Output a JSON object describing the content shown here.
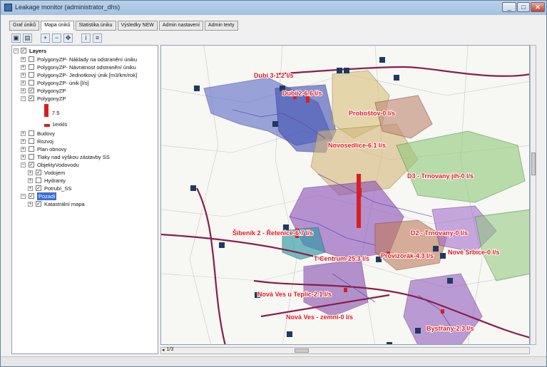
{
  "window": {
    "title": "Leakage monitor (administrator_dhs)"
  },
  "window_buttons": {
    "minimize": "_",
    "maximize": "□",
    "close": "✕"
  },
  "tabs": [
    "Graf úniků",
    "Mapa úniků",
    "Statistika úniku",
    "Výsledky NEW",
    "Admin nastavení",
    "Admin texty"
  ],
  "active_tab": "Mapa úniků",
  "toolbar": {
    "icons": [
      "save-icon",
      "print-icon",
      "zoom-in-icon",
      "zoom-out-icon",
      "pan-icon",
      "info-icon",
      "legend-icon"
    ]
  },
  "layers": {
    "root": "Layers",
    "items": [
      {
        "label": "PolygonyZP- Náklady na odstranění úniku",
        "checked": false,
        "expand": "+"
      },
      {
        "label": "PolygonyZP- Návratnost odstranění úniku",
        "checked": false,
        "expand": "+"
      },
      {
        "label": "PolygonyZP- Jednotkový únik [m3/km/rok]",
        "checked": false,
        "expand": "+"
      },
      {
        "label": "PolygonyZP- únik [l/s]",
        "checked": false,
        "expand": "+"
      },
      {
        "label": "PolygonyZP",
        "checked": true,
        "expand": "+"
      },
      {
        "label": "PolygonyZP",
        "checked": true,
        "expand": "−"
      },
      {
        "label": "Budovy",
        "checked": false,
        "expand": "+"
      },
      {
        "label": "Rozvoj",
        "checked": false,
        "expand": "+"
      },
      {
        "label": "Plan obnovy",
        "checked": false,
        "expand": "+"
      },
      {
        "label": "Tlaky nad výškou zástavby SS",
        "checked": false,
        "expand": "+"
      },
      {
        "label": "ObjektyVodovodu",
        "checked": true,
        "expand": "−"
      },
      {
        "label": "Vodojem",
        "checked": true,
        "expand": "+"
      },
      {
        "label": "Hydranty",
        "checked": false,
        "expand": "+"
      },
      {
        "label": "Potrubí_SS",
        "checked": true,
        "expand": "+"
      },
      {
        "label": "Pozadí",
        "checked": true,
        "expand": "−"
      },
      {
        "label": "Katastrální mapa",
        "checked": true,
        "expand": "+"
      }
    ],
    "legend_high": "7.5",
    "legend_low": "1exkls"
  },
  "map_labels": [
    "Dubí 3-1.2 l/s",
    "Dubí 2-6.6 l/s",
    "Proboštov-0 l/s",
    "Novosedlice-6.1 l/s",
    "D3 - Trnovany jih-0 l/s",
    "Šibeník 2 - Řetenice-6.7 l/s",
    "D2 - Trnovany-0 l/s",
    "Nové Srbice-0 l/s",
    "T-Centrum-25.3 l/s",
    "Provizorák-4.3 l/s",
    "Nová Ves u Teplic-2.1 l/s",
    "Nová Ves - zemní-0 l/s",
    "Bystřany-2.3 l/s"
  ],
  "leak_rates": [
    1.2,
    6.6,
    0,
    6.1,
    0,
    6.7,
    0,
    0,
    25.3,
    4.3,
    2.1,
    0,
    2.3
  ],
  "colors": {
    "leak_bar": "#d81e22",
    "label": "#e4141a",
    "road": "#8b1d4a",
    "node": "#1f3a5f"
  },
  "bottom": {
    "pages": "1/3"
  }
}
